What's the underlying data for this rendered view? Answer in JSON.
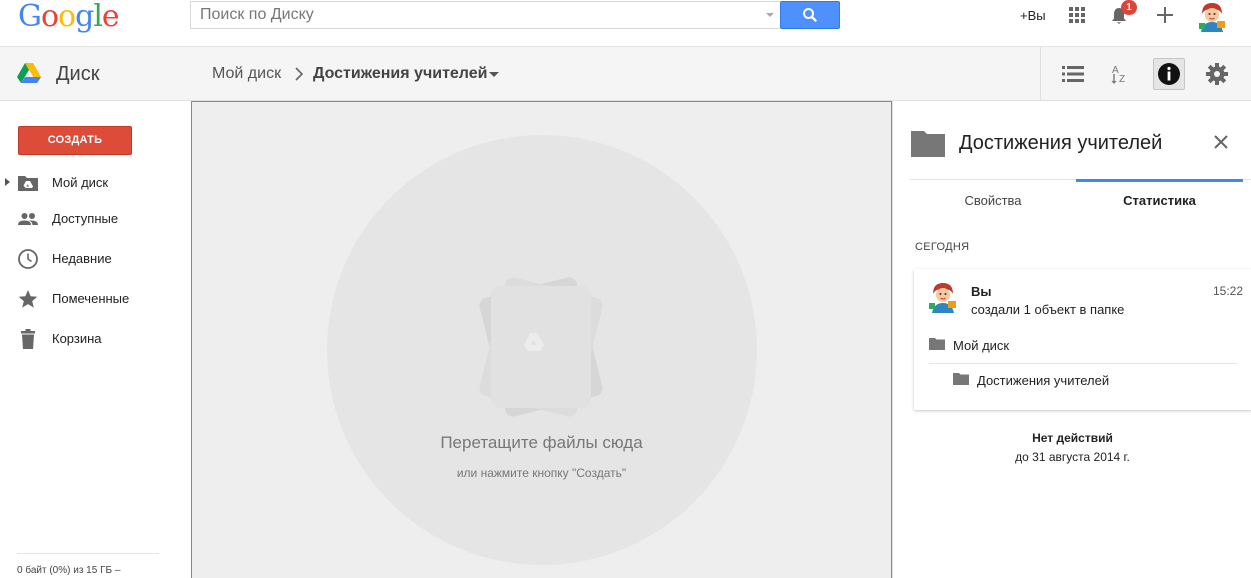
{
  "top_bar": {
    "logo_letters": [
      "G",
      "o",
      "o",
      "g",
      "l",
      "e"
    ],
    "logo_colors": [
      "#4285f4",
      "#ea4335",
      "#fbbc05",
      "#4285f4",
      "#34a853",
      "#ea4335"
    ],
    "search_placeholder": "Поиск по Диску",
    "search_button_icon": "search-icon",
    "plus_you": "+Вы",
    "apps_icon": "apps-grid-icon",
    "notification_count": "1",
    "add_icon": "plus-icon",
    "accent_color": "#4d90fe"
  },
  "drive_header": {
    "app_title": "Диск",
    "breadcrumb": {
      "root": "Мой диск",
      "current": "Достижения учителей"
    },
    "toolbar_icons": [
      "list-view-icon",
      "sort-az-icon",
      "info-icon",
      "settings-icon"
    ]
  },
  "sidebar": {
    "create_label": "СОЗДАТЬ",
    "create_color": "#dd4b39",
    "items": [
      {
        "label": "Мой диск",
        "icon": "drive-folder-icon"
      },
      {
        "label": "Доступные",
        "icon": "people-icon"
      },
      {
        "label": "Недавние",
        "icon": "clock-icon"
      },
      {
        "label": "Помеченные",
        "icon": "star-icon"
      },
      {
        "label": "Корзина",
        "icon": "trash-icon"
      }
    ],
    "storage_text": "0 байт (0%) из 15 ГБ –"
  },
  "main": {
    "drop_title": "Перетащите файлы сюда",
    "drop_subtitle": "или нажмите кнопку \"Создать\""
  },
  "details_panel": {
    "title": "Достижения учителей",
    "tabs": [
      {
        "label": "Свойства",
        "active": false
      },
      {
        "label": "Статистика",
        "active": true
      }
    ],
    "today_label": "СЕГОДНЯ",
    "activity": {
      "user": "Вы",
      "time": "15:22",
      "description": "создали 1 объект в папке",
      "parent_folder": "Мой диск",
      "child_folder": "Достижения учителей"
    },
    "no_actions_title": "Нет действий",
    "no_actions_date": "до 31 августа 2014 г."
  }
}
